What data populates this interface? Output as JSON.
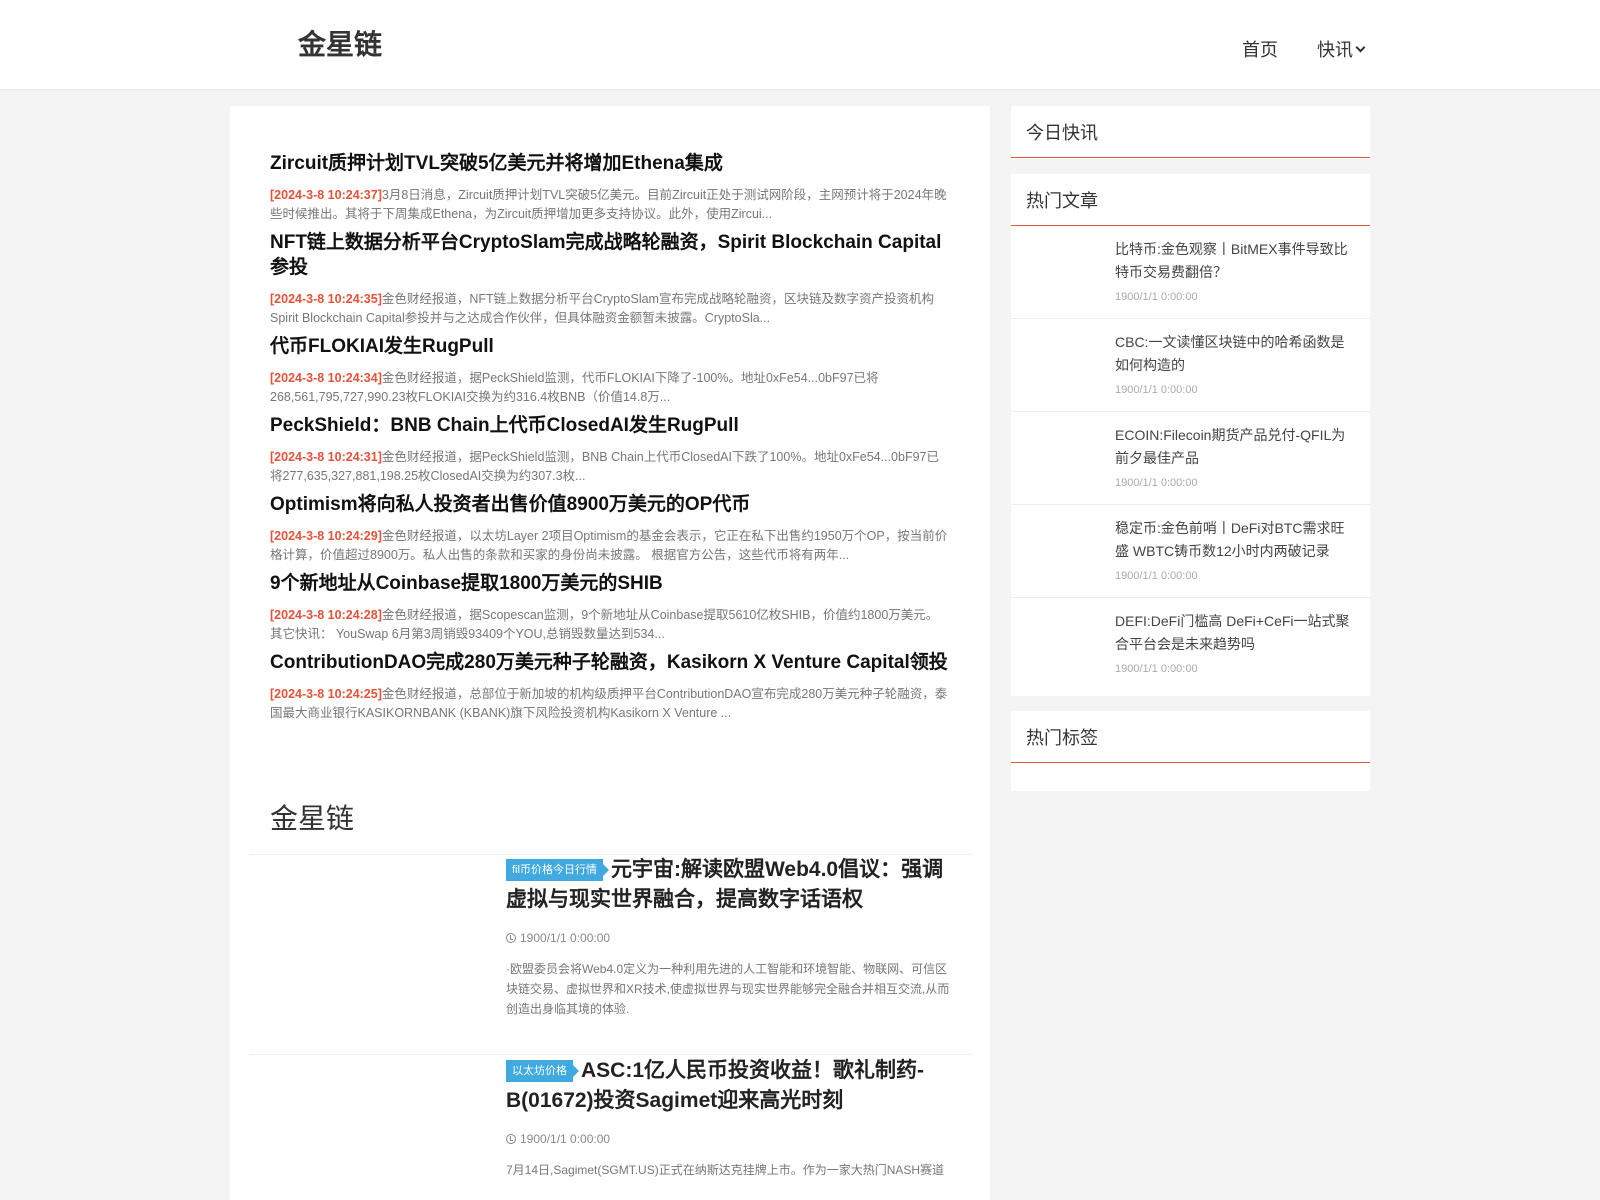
{
  "header": {
    "logo": "金星链",
    "nav": {
      "home": "首页",
      "news": "快讯"
    }
  },
  "news": [
    {
      "title": "Zircuit质押计划TVL突破5亿美元并将增加Ethena集成",
      "time": "[2024-3-8 10:24:37]",
      "desc": "3月8日消息，Zircuit质押计划TVL突破5亿美元。目前Zircuit正处于测试网阶段，主网预计将于2024年晚些时候推出。其将于下周集成Ethena，为Zircuit质押增加更多支持协议。此外，使用Zircui..."
    },
    {
      "title": "NFT链上数据分析平台CryptoSlam完成战略轮融资，Spirit Blockchain Capital参投",
      "time": "[2024-3-8 10:24:35]",
      "desc": "金色财经报道，NFT链上数据分析平台CryptoSlam宣布完成战略轮融资，区块链及数字资产投资机构Spirit Blockchain Capital参投并与之达成合作伙伴，但具体融资金额暂未披露。CryptoSla..."
    },
    {
      "title": "代币FLOKIAI发生RugPull",
      "time": "[2024-3-8 10:24:34]",
      "desc": "金色财经报道，据PeckShield监测，代币FLOKIAI下降了-100%。地址0xFe54...0bF97已将268,561,795,727,990.23枚FLOKIAI交换为约316.4枚BNB（价值14.8万..."
    },
    {
      "title": "PeckShield：BNB Chain上代币ClosedAI发生RugPull",
      "time": "[2024-3-8 10:24:31]",
      "desc": "金色财经报道，据PeckShield监测，BNB Chain上代币ClosedAI下跌了100%。地址0xFe54...0bF97已将277,635,327,881,198.25枚ClosedAI交换为约307.3枚..."
    },
    {
      "title": "Optimism将向私人投资者出售价值8900万美元的OP代币",
      "time": "[2024-3-8 10:24:29]",
      "desc": "金色财经报道，以太坊Layer 2项目Optimism的基金会表示，它正在私下出售约1950万个OP，按当前价格计算，价值超过8900万。私人出售的条款和买家的身份尚未披露。 根据官方公告，这些代币将有两年..."
    },
    {
      "title": "9个新地址从Coinbase提取1800万美元的SHIB",
      "time": "[2024-3-8 10:24:28]",
      "desc": "金色财经报道，据Scopescan监测，9个新地址从Coinbase提取5610亿枚SHIB，价值约1800万美元。 其它快讯： YouSwap 6月第3周销毁93409个YOU,总销毁数量达到534..."
    },
    {
      "title": "ContributionDAO完成280万美元种子轮融资，Kasikorn X Venture Capital领投",
      "time": "[2024-3-8 10:24:25]",
      "desc": "金色财经报道，总部位于新加坡的机构级质押平台ContributionDAO宣布完成280万美元种子轮融资，泰国最大商业银行KASIKORNBANK (KBANK)旗下风险投资机构Kasikorn X Venture ..."
    }
  ],
  "section": {
    "title": "金星链"
  },
  "articles": [
    {
      "tag": "fil币价格今日行情",
      "title": "元宇宙:解读欧盟Web4.0倡议：强调虚拟与现实世界融合，提高数字话语权",
      "date": "1900/1/1 0:00:00",
      "summary": "·欧盟委员会将Web4.0定义为一种利用先进的人工智能和环境智能、物联网、可信区块链交易、虚拟世界和XR技术,使虚拟世界与现实世界能够完全融合并相互交流,从而创造出身临其境的体验."
    },
    {
      "tag": "以太坊价格",
      "title": "ASC:1亿人民币投资收益！歌礼制药-B(01672)投资Sagimet迎来高光时刻",
      "date": "1900/1/1 0:00:00",
      "summary": "7月14日,Sagimet(SGMT.US)正式在纳斯达克挂牌上市。作为一家大热门NASH赛道"
    }
  ],
  "sidebar": {
    "today_title": "今日快讯",
    "hot_title": "热门文章",
    "tags_title": "热门标签",
    "hot": [
      {
        "title": "比特币:金色观察丨BitMEX事件导致比特币交易费翻倍？",
        "date": "1900/1/1 0:00:00"
      },
      {
        "title": "CBC:一文读懂区块链中的哈希函数是如何构造的",
        "date": "1900/1/1 0:00:00"
      },
      {
        "title": "ECOIN:Filecoin期货产品兑付-QFIL为前夕最佳产品",
        "date": "1900/1/1 0:00:00"
      },
      {
        "title": "稳定币:金色前哨丨DeFi对BTC需求旺盛 WBTC铸币数12小时内两破记录",
        "date": "1900/1/1 0:00:00"
      },
      {
        "title": "DEFI:DeFi门槛高 DeFi+CeFi一站式聚合平台会是未来趋势吗",
        "date": "1900/1/1 0:00:00"
      }
    ]
  },
  "colors": {
    "accent": "#e4533a",
    "tag": "#3fa9e0"
  }
}
